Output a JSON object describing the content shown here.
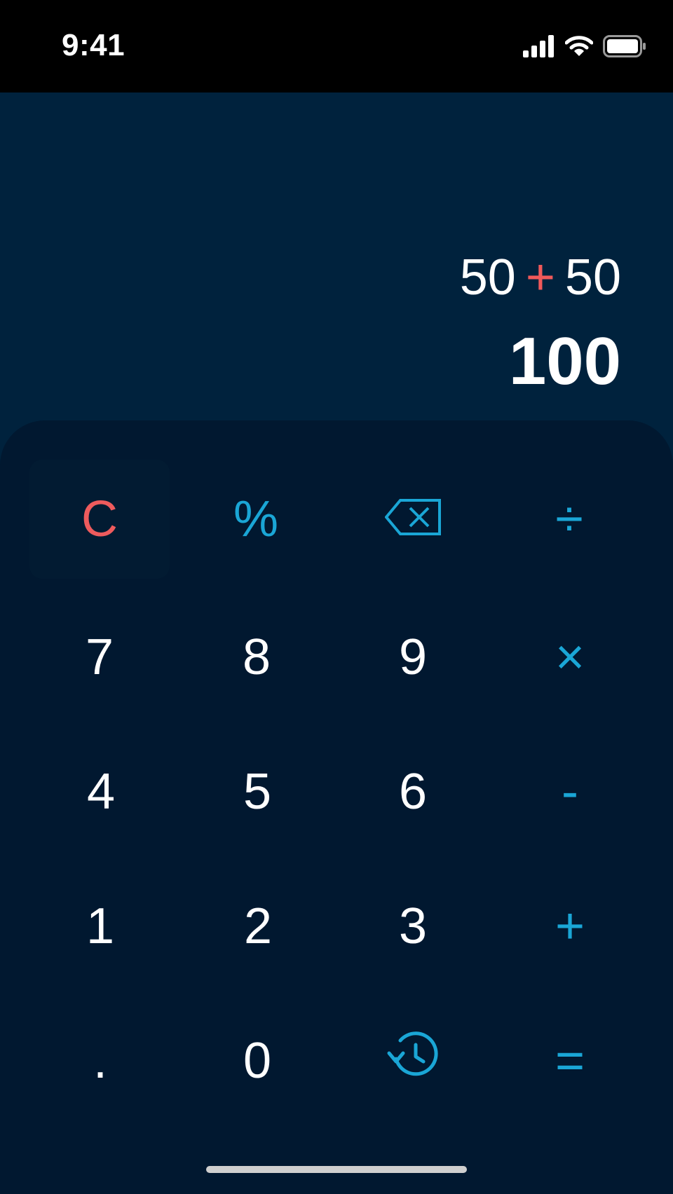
{
  "status_bar": {
    "time": "9:41",
    "icons": [
      "cellular-signal-icon",
      "wifi-icon",
      "battery-icon"
    ]
  },
  "display": {
    "expression": {
      "left_operand": "50",
      "operator": "+",
      "right_operand": "50"
    },
    "result": "100"
  },
  "keypad": {
    "row1": {
      "clear": "C",
      "percent": "%",
      "backspace_icon": "backspace-icon",
      "divide": "÷"
    },
    "row2": {
      "seven": "7",
      "eight": "8",
      "nine": "9",
      "multiply": "×"
    },
    "row3": {
      "four": "4",
      "five": "5",
      "six": "6",
      "subtract": "-"
    },
    "row4": {
      "one": "1",
      "two": "2",
      "three": "3",
      "add": "+"
    },
    "row5": {
      "decimal": ".",
      "zero": "0",
      "history_icon": "history-icon",
      "equals": "="
    }
  },
  "colors": {
    "background": "#00223d",
    "keypad_background": "#011830",
    "accent": "#1aa6d6",
    "clear_red": "#ee5b5d",
    "text": "#ffffff"
  }
}
